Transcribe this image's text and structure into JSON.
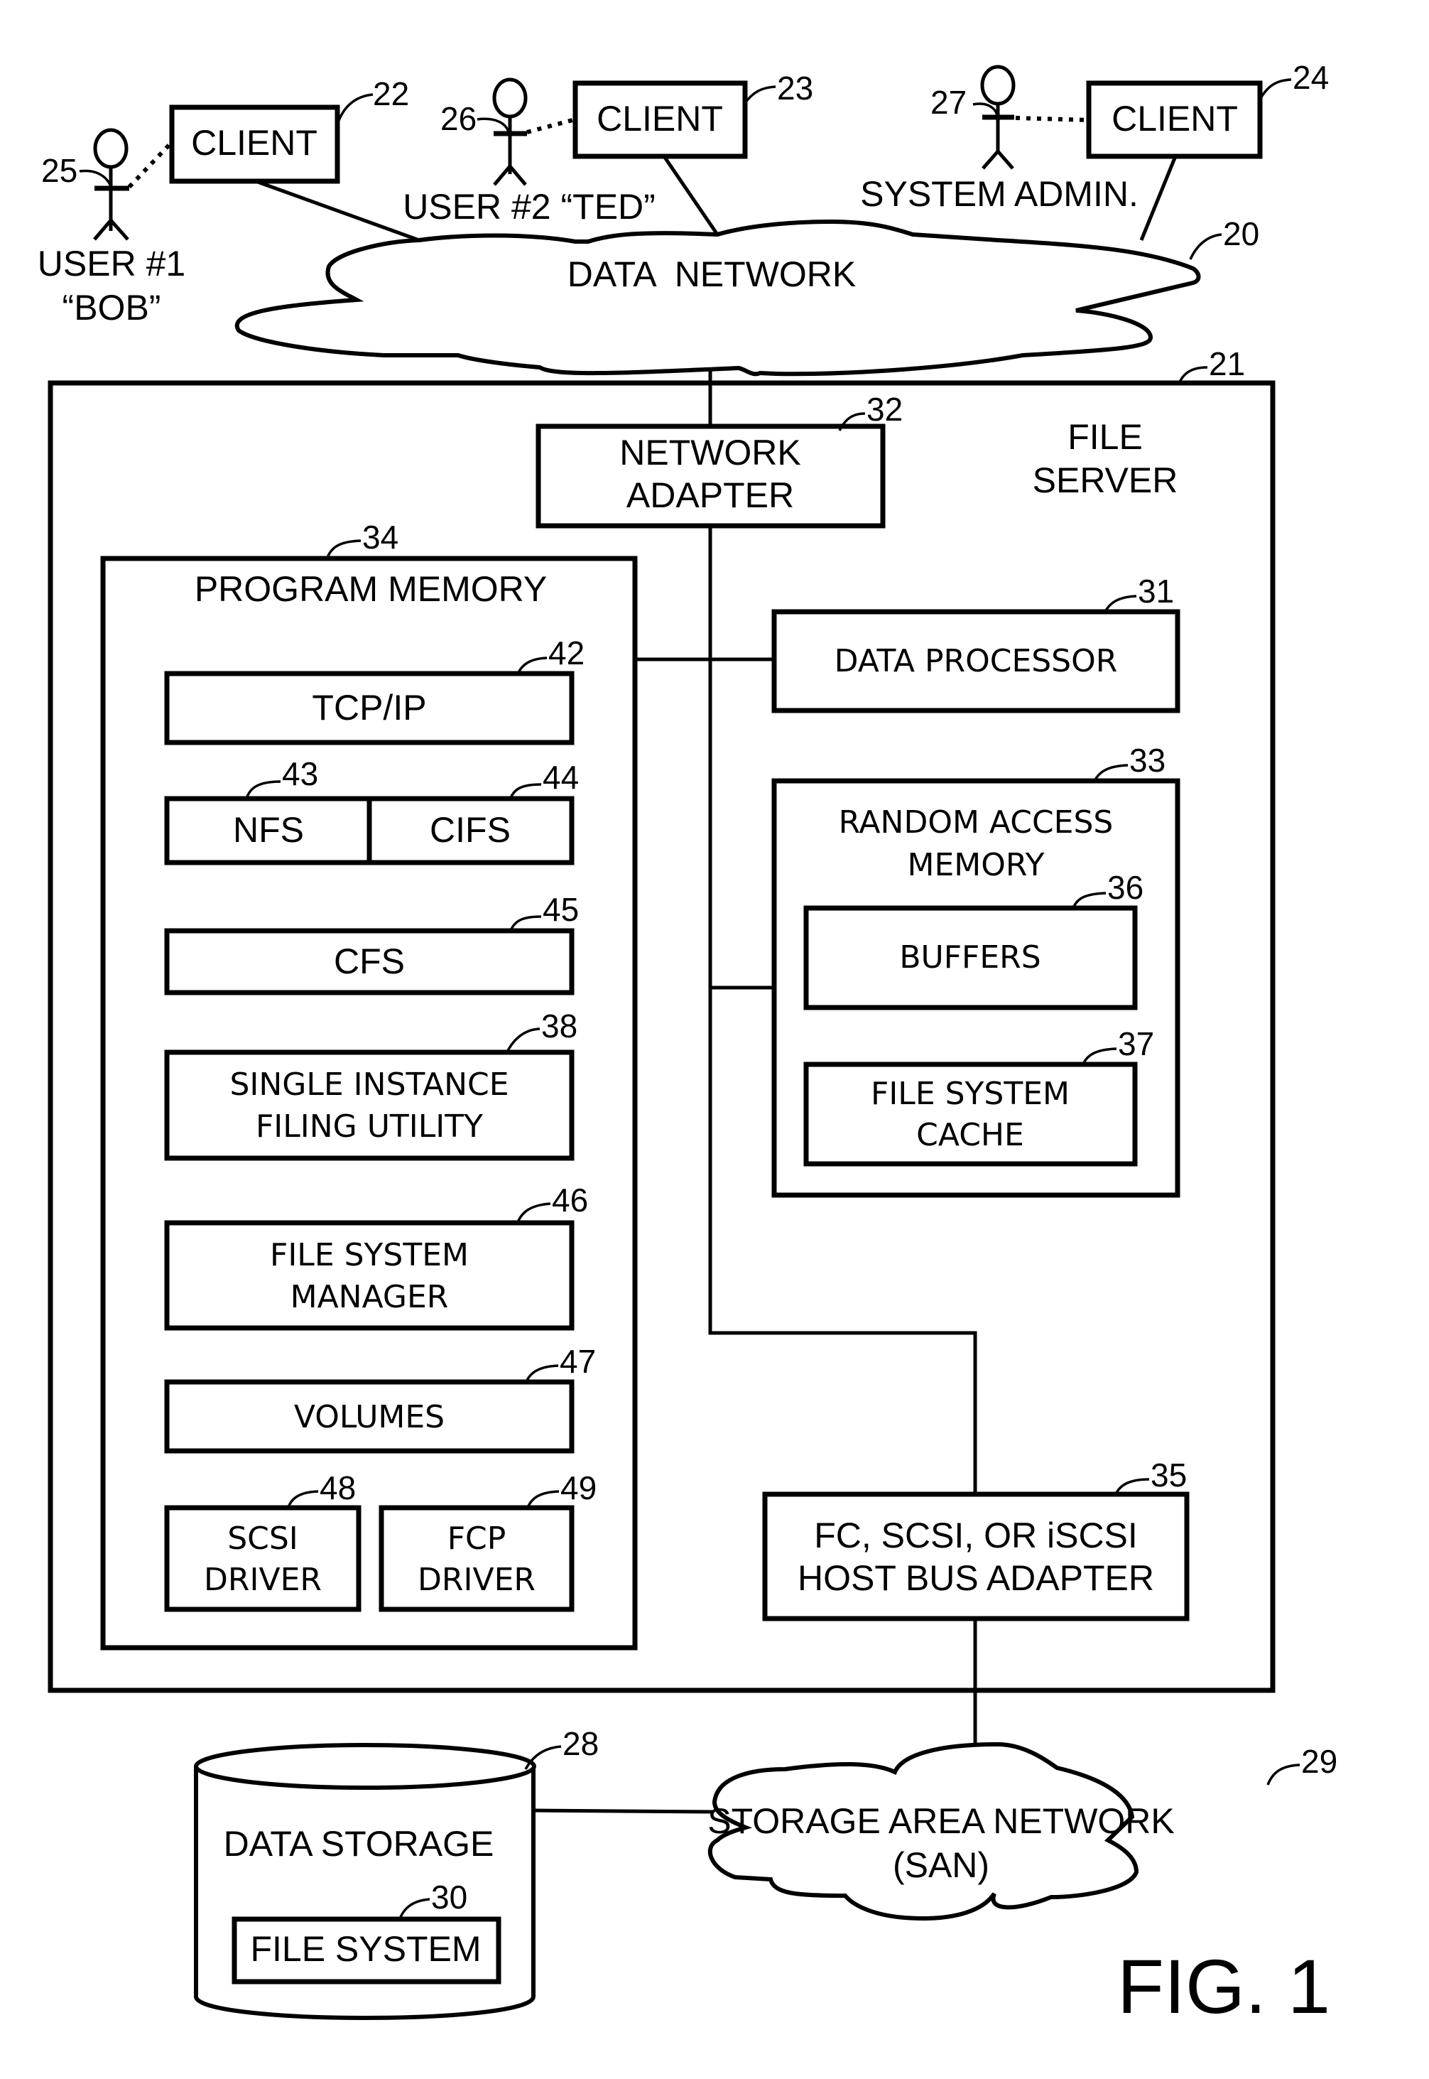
{
  "figure": {
    "label": "FIG. 1",
    "colors": {
      "ink": "#000000",
      "background": "#ffffff"
    }
  },
  "clients": [
    {
      "id": "22",
      "label": "CLIENT"
    },
    {
      "id": "23",
      "label": "CLIENT"
    },
    {
      "id": "24",
      "label": "CLIENT"
    }
  ],
  "users": [
    {
      "id": "25",
      "label_line1": "USER #1",
      "label_line2": "“BOB”"
    },
    {
      "id": "26",
      "label_line1": "USER #2 “TED”"
    },
    {
      "id": "27",
      "label_line1": "SYSTEM ADMIN."
    }
  ],
  "data_network": {
    "id": "20",
    "label": "DATA  NETWORK"
  },
  "file_server": {
    "id": "21",
    "label_line1": "FILE",
    "label_line2": "SERVER",
    "network_adapter": {
      "id": "32",
      "line1": "NETWORK",
      "line2": "ADAPTER"
    },
    "program_memory": {
      "id": "34",
      "label": "PROGRAM MEMORY",
      "modules": {
        "tcpip": {
          "id": "42",
          "label": "TCP/IP"
        },
        "nfs": {
          "id": "43",
          "label": "NFS"
        },
        "cifs": {
          "id": "44",
          "label": "CIFS"
        },
        "cfs": {
          "id": "45",
          "label": "CFS"
        },
        "sifu": {
          "id": "38",
          "line1": "SINGLE INSTANCE",
          "line2": "FILING UTILITY"
        },
        "fsm": {
          "id": "46",
          "line1": "FILE SYSTEM",
          "line2": "MANAGER"
        },
        "volumes": {
          "id": "47",
          "label": "VOLUMES"
        },
        "scsi_driver": {
          "id": "48",
          "line1": "SCSI",
          "line2": "DRIVER"
        },
        "fcp_driver": {
          "id": "49",
          "line1": "FCP",
          "line2": "DRIVER"
        }
      }
    },
    "data_processor": {
      "id": "31",
      "label": "DATA PROCESSOR"
    },
    "ram": {
      "id": "33",
      "line1": "RANDOM ACCESS",
      "line2": "MEMORY",
      "buffers": {
        "id": "36",
        "label": "BUFFERS"
      },
      "fs_cache": {
        "id": "37",
        "line1": "FILE SYSTEM",
        "line2": "CACHE"
      }
    },
    "hba": {
      "id": "35",
      "line1": "FC, SCSI, OR iSCSI",
      "line2": "HOST BUS ADAPTER"
    }
  },
  "data_storage": {
    "id": "28",
    "label": "DATA STORAGE",
    "file_system": {
      "id": "30",
      "label": "FILE SYSTEM"
    }
  },
  "san": {
    "id": "29",
    "line1": "STORAGE AREA NETWORK",
    "line2": "(SAN)"
  }
}
